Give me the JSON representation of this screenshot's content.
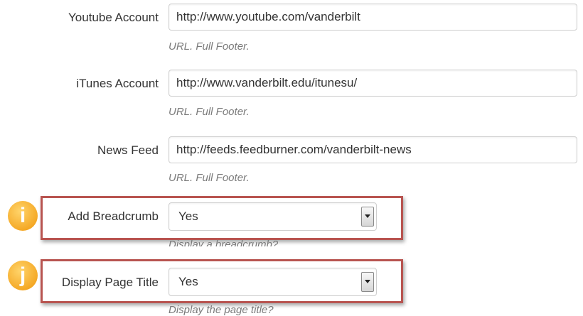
{
  "fields": {
    "youtube": {
      "label": "Youtube Account",
      "value": "http://www.youtube.com/vanderbilt",
      "help": "URL. Full Footer."
    },
    "itunes": {
      "label": "iTunes Account",
      "value": "http://www.vanderbilt.edu/itunesu/",
      "help": "URL. Full Footer."
    },
    "news": {
      "label": "News Feed",
      "value": "http://feeds.feedburner.com/vanderbilt-news",
      "help": "URL. Full Footer."
    }
  },
  "selects": {
    "breadcrumb": {
      "label": "Add Breadcrumb",
      "value": "Yes",
      "help": "Display a breadcrumb?"
    },
    "page_title": {
      "label": "Display Page Title",
      "value": "Yes",
      "help": "Display the page title?"
    }
  },
  "annotations": {
    "i": "i",
    "j": "j"
  },
  "colors": {
    "highlight": "#b85450",
    "badge": "#f4a622",
    "help_text": "#7a7a7a"
  }
}
